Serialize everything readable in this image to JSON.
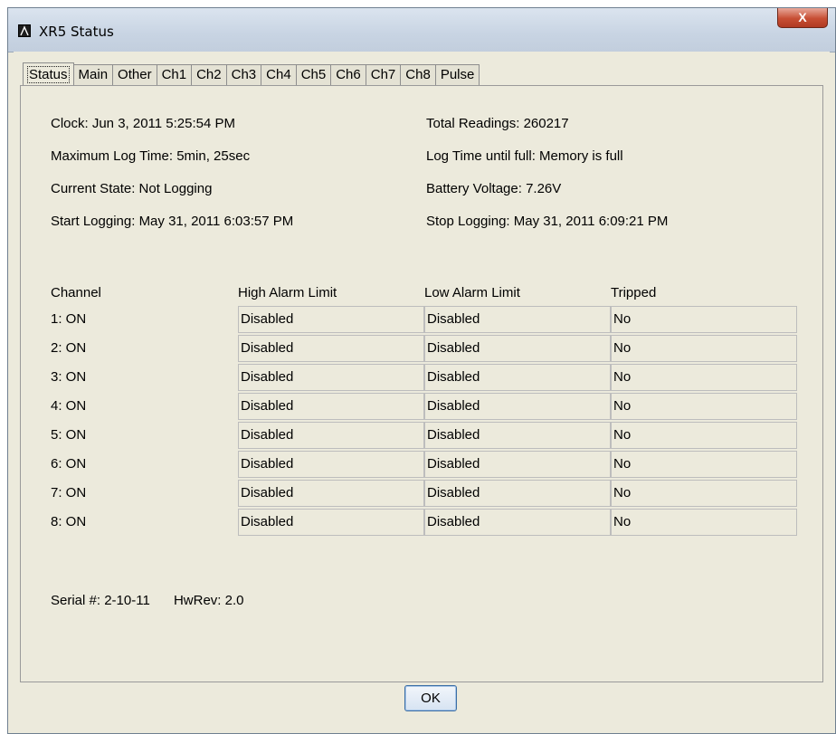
{
  "window": {
    "title": "XR5 Status",
    "close_label": "X"
  },
  "tabs": [
    "Status",
    "Main",
    "Other",
    "Ch1",
    "Ch2",
    "Ch3",
    "Ch4",
    "Ch5",
    "Ch6",
    "Ch7",
    "Ch8",
    "Pulse"
  ],
  "status": {
    "clock": "Clock: Jun 3, 2011 5:25:54 PM",
    "max_log_time": "Maximum Log Time: 5min, 25sec",
    "current_state": "Current State: Not Logging",
    "start_logging": "Start Logging: May 31, 2011 6:03:57 PM",
    "total_readings": "Total Readings: 260217",
    "log_time_until_full": "Log Time until full: Memory is full",
    "battery_voltage": "Battery Voltage: 7.26V",
    "stop_logging": "Stop Logging: May 31, 2011 6:09:21 PM"
  },
  "table": {
    "headers": [
      "Channel",
      "High Alarm Limit",
      "Low Alarm Limit",
      "Tripped"
    ],
    "rows": [
      {
        "channel": "1: ON",
        "high": "Disabled",
        "low": "Disabled",
        "tripped": "No"
      },
      {
        "channel": "2: ON",
        "high": "Disabled",
        "low": "Disabled",
        "tripped": "No"
      },
      {
        "channel": "3: ON",
        "high": "Disabled",
        "low": "Disabled",
        "tripped": "No"
      },
      {
        "channel": "4: ON",
        "high": "Disabled",
        "low": "Disabled",
        "tripped": "No"
      },
      {
        "channel": "5: ON",
        "high": "Disabled",
        "low": "Disabled",
        "tripped": "No"
      },
      {
        "channel": "6: ON",
        "high": "Disabled",
        "low": "Disabled",
        "tripped": "No"
      },
      {
        "channel": "7: ON",
        "high": "Disabled",
        "low": "Disabled",
        "tripped": "No"
      },
      {
        "channel": "8: ON",
        "high": "Disabled",
        "low": "Disabled",
        "tripped": "No"
      }
    ]
  },
  "footer": {
    "serial": "Serial #:  2-10-11",
    "hwrev": "HwRev: 2.0"
  },
  "ok_label": "OK"
}
